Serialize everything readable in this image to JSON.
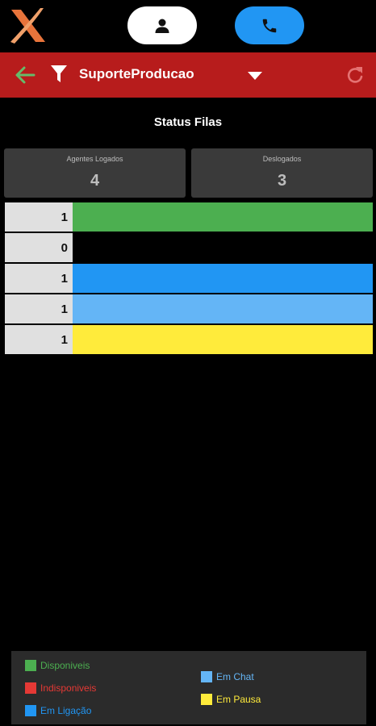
{
  "top_bar": {
    "logo_icon": "x-logo-icon",
    "user_button_icon": "person-icon",
    "call_button_icon": "phone-icon"
  },
  "header": {
    "queue_name": "SuporteProducao",
    "back_icon": "arrow-left-icon",
    "filter_icon": "filter-icon",
    "dropdown_icon": "caret-down-icon",
    "refresh_icon": "refresh-icon",
    "background": "#b71c1c"
  },
  "title": "Status Filas",
  "stats": {
    "logged_label": "Agentes Logados",
    "logged_value": "4",
    "logged_out_label": "Deslogados",
    "logged_out_value": "3"
  },
  "rows": [
    {
      "count": "1",
      "color": "#4caf50"
    },
    {
      "count": "0",
      "color": "#000000"
    },
    {
      "count": "1",
      "color": "#2196f3"
    },
    {
      "count": "1",
      "color": "#64b5f6"
    },
    {
      "count": "1",
      "color": "#ffeb3b"
    }
  ],
  "legend": [
    {
      "label": "Disponiveis",
      "color": "#4caf50"
    },
    {
      "label": "Indisponiveis",
      "color": "#e53935"
    },
    {
      "label": "Em Ligação",
      "color": "#2196f3"
    },
    {
      "label": "Em Chat",
      "color": "#64b5f6"
    },
    {
      "label": "Em Pausa",
      "color": "#ffeb3b"
    }
  ]
}
